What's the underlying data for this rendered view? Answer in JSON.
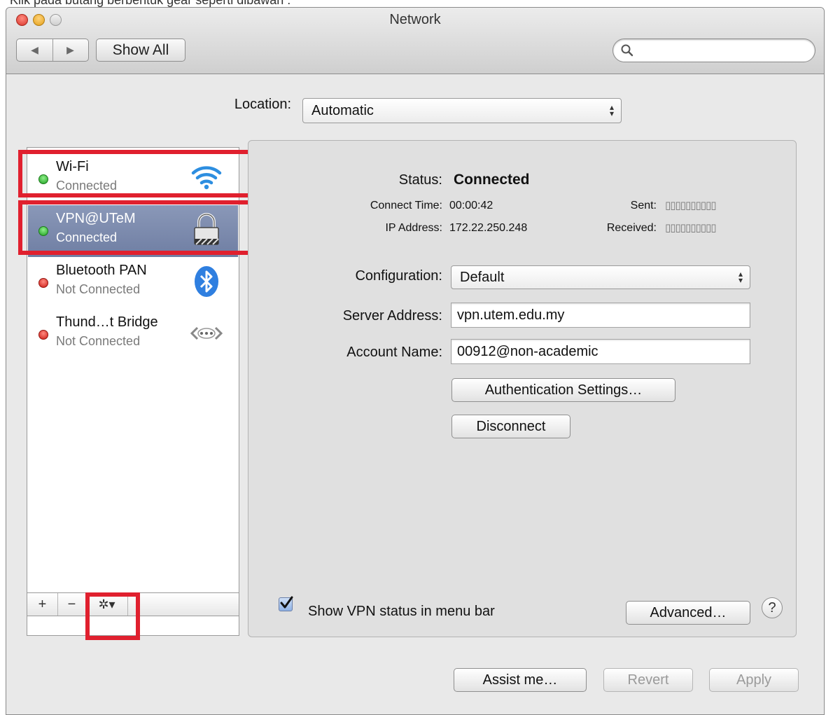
{
  "caption": "Klik pada butang berbentuk gear seperti dibawah :",
  "window": {
    "title": "Network"
  },
  "toolbar": {
    "back_glyph": "◀",
    "forward_glyph": "▶",
    "show_all": "Show All",
    "search_placeholder": ""
  },
  "location": {
    "label": "Location:",
    "value": "Automatic"
  },
  "services": [
    {
      "name": "Wi-Fi",
      "status": "Connected",
      "state": "green",
      "icon": "wifi-icon",
      "selected": false
    },
    {
      "name": "VPN@UTeM",
      "status": "Connected",
      "state": "green",
      "icon": "lock-icon",
      "selected": true
    },
    {
      "name": "Bluetooth PAN",
      "status": "Not Connected",
      "state": "red",
      "icon": "bluetooth-icon",
      "selected": false
    },
    {
      "name": "Thund…t Bridge",
      "status": "Not Connected",
      "state": "red",
      "icon": "thunderbolt-bridge-icon",
      "selected": false
    }
  ],
  "sidebar_buttons": {
    "add": "+",
    "remove": "−",
    "gear": "✲▾"
  },
  "detail": {
    "status_label": "Status:",
    "status_value": "Connected",
    "connect_time_label": "Connect Time:",
    "connect_time_value": "00:00:42",
    "ip_label": "IP Address:",
    "ip_value": "172.22.250.248",
    "sent_label": "Sent:",
    "sent_value": "▯▯▯▯▯▯▯▯▯▯",
    "received_label": "Received:",
    "received_value": "▯▯▯▯▯▯▯▯▯▯",
    "configuration_label": "Configuration:",
    "configuration_value": "Default",
    "server_label": "Server Address:",
    "server_value": "vpn.utem.edu.my",
    "account_label": "Account Name:",
    "account_value": "00912@non-academic",
    "auth_button": "Authentication Settings…",
    "disconnect_button": "Disconnect",
    "show_vpn_label": "Show VPN status in menu bar",
    "show_vpn_checked": true,
    "advanced_button": "Advanced…",
    "help_glyph": "?"
  },
  "footer": {
    "assist": "Assist me…",
    "revert": "Revert",
    "apply": "Apply"
  },
  "colors": {
    "highlight": "#e0202e",
    "selection": "#7a88ab"
  }
}
